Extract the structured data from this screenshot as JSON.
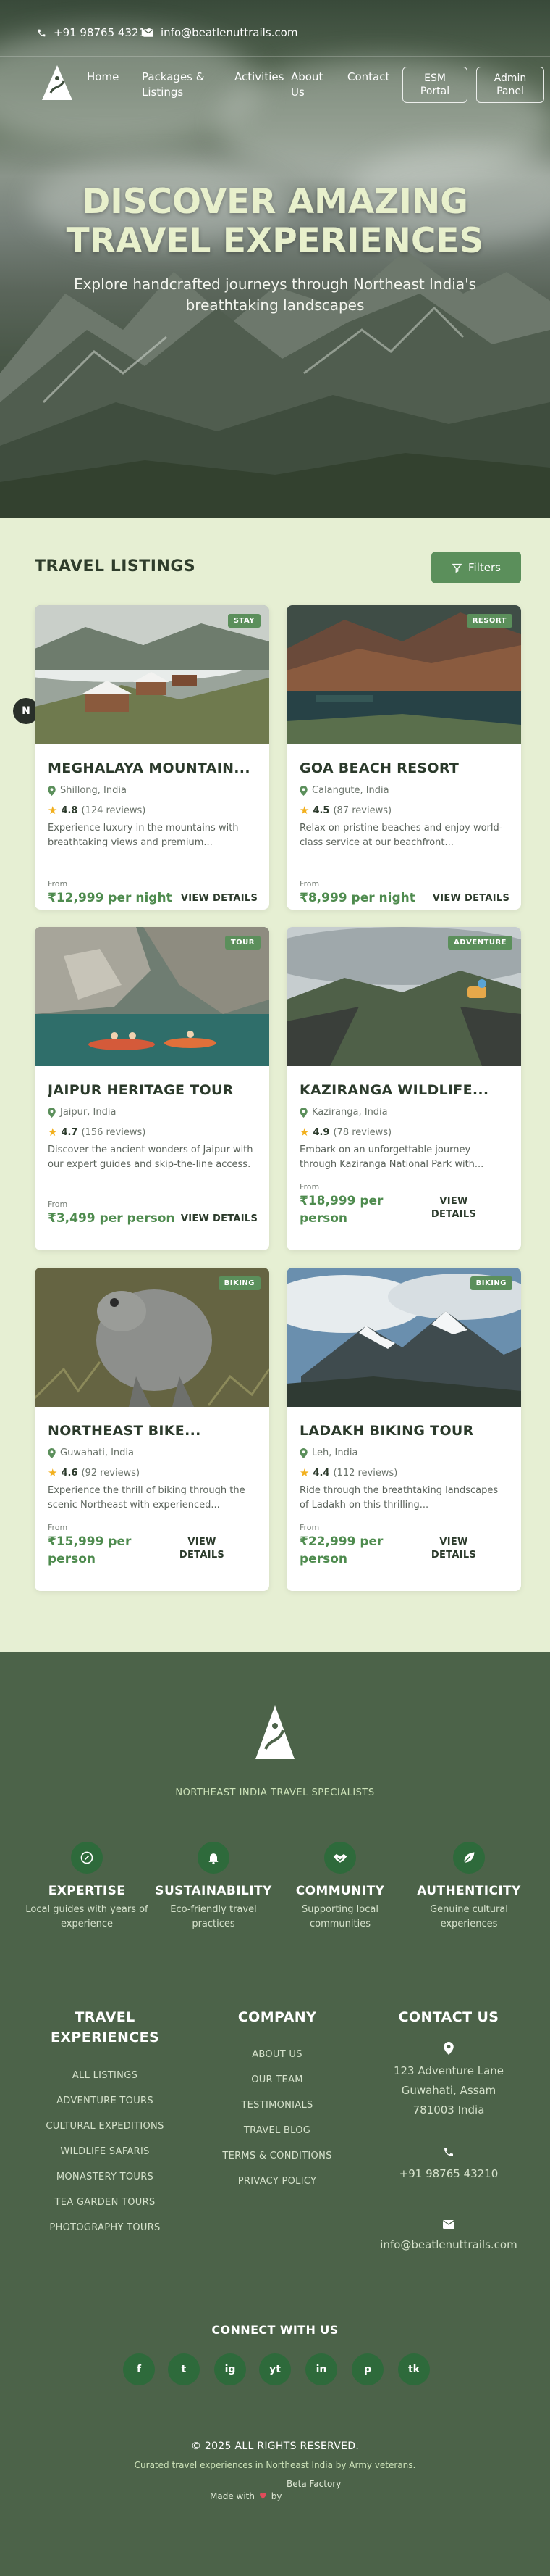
{
  "topbar": {
    "phone": "+91 98765 43210",
    "email": "info@beatlenuttrails.com"
  },
  "nav": {
    "links": [
      "Home",
      "Packages & Listings",
      "Activities",
      "About Us",
      "Contact"
    ],
    "esm_portal": "ESM Portal",
    "admin_panel": "Admin Panel"
  },
  "hero": {
    "title_line1": "DISCOVER AMAZING",
    "title_line2": "TRAVEL EXPERIENCES",
    "subtitle": "Explore handcrafted journeys through Northeast India's breathtaking landscapes"
  },
  "listings": {
    "title": "TRAVEL LISTINGS",
    "filters_label": "Filters",
    "side_badge": "N",
    "cards": [
      {
        "tag": "STAY",
        "title": "MEGHALAYA MOUNTAIN...",
        "location": "Shillong, India",
        "rating": "4.8",
        "reviews": "(124 reviews)",
        "desc": "Experience luxury in the mountains with breathtaking views and premium...",
        "from": "From",
        "price": "₹12,999 per night",
        "cta": "VIEW DETAILS"
      },
      {
        "tag": "RESORT",
        "title": "GOA BEACH RESORT",
        "location": "Calangute, India",
        "rating": "4.5",
        "reviews": "(87 reviews)",
        "desc": "Relax on pristine beaches and enjoy world-class service at our beachfront...",
        "from": "From",
        "price": "₹8,999 per night",
        "cta": "VIEW DETAILS"
      },
      {
        "tag": "TOUR",
        "title": "JAIPUR HERITAGE TOUR",
        "location": "Jaipur, India",
        "rating": "4.7",
        "reviews": "(156 reviews)",
        "desc": "Discover the ancient wonders of Jaipur with our expert guides and skip-the-line access.",
        "from": "From",
        "price": "₹3,499 per person",
        "cta": "VIEW DETAILS"
      },
      {
        "tag": "ADVENTURE",
        "title": "KAZIRANGA WILDLIFE...",
        "location": "Kaziranga, India",
        "rating": "4.9",
        "reviews": "(78 reviews)",
        "desc": "Embark on an unforgettable journey through Kaziranga National Park with...",
        "from": "From",
        "price": "₹18,999 per person",
        "cta": "VIEW DETAILS"
      },
      {
        "tag": "BIKING",
        "title": "NORTHEAST BIKE...",
        "location": "Guwahati, India",
        "rating": "4.6",
        "reviews": "(92 reviews)",
        "desc": "Experience the thrill of biking through the scenic Northeast with experienced...",
        "from": "From",
        "price": "₹15,999 per person",
        "cta": "VIEW DETAILS"
      },
      {
        "tag": "BIKING",
        "title": "LADAKH BIKING TOUR",
        "location": "Leh, India",
        "rating": "4.4",
        "reviews": "(112 reviews)",
        "desc": "Ride through the breathtaking landscapes of Ladakh on this thrilling...",
        "from": "From",
        "price": "₹22,999 per person",
        "cta": "VIEW DETAILS"
      }
    ]
  },
  "footer": {
    "tagline": "NORTHEAST INDIA TRAVEL SPECIALISTS",
    "features": [
      {
        "icon": "compass-icon",
        "title": "EXPERTISE",
        "desc": "Local guides with years of experience"
      },
      {
        "icon": "bell-icon",
        "title": "SUSTAINABILITY",
        "desc": "Eco-friendly travel practices"
      },
      {
        "icon": "handshake-icon",
        "title": "COMMUNITY",
        "desc": "Supporting local communities"
      },
      {
        "icon": "leaf-icon",
        "title": "AUTHENTICITY",
        "desc": "Genuine cultural experiences"
      }
    ],
    "col1": {
      "title": "TRAVEL EXPERIENCES",
      "links": [
        "ALL LISTINGS",
        "ADVENTURE TOURS",
        "CULTURAL EXPEDITIONS",
        "WILDLIFE SAFARIS",
        "MONASTERY TOURS",
        "TEA GARDEN TOURS",
        "PHOTOGRAPHY TOURS"
      ]
    },
    "col2": {
      "title": "COMPANY",
      "links": [
        "ABOUT US",
        "OUR TEAM",
        "TESTIMONIALS",
        "TRAVEL BLOG",
        "TERMS & CONDITIONS",
        "PRIVACY POLICY"
      ]
    },
    "col3": {
      "title": "CONTACT US",
      "address": "123 Adventure Lane Guwahati, Assam 781003 India",
      "phone": "+91 98765 43210",
      "email": "info@beatlenuttrails.com"
    },
    "connect_title": "CONNECT WITH US",
    "social": [
      "f",
      "t",
      "ig",
      "yt",
      "in",
      "p",
      "tk"
    ],
    "copyright": "© 2025 ALL RIGHTS RESERVED.",
    "copy_line2": "Curated travel experiences in Northeast India by Army veterans.",
    "made_with": "Made with",
    "made_by": "by",
    "beta_factory": "Beta Factory"
  }
}
